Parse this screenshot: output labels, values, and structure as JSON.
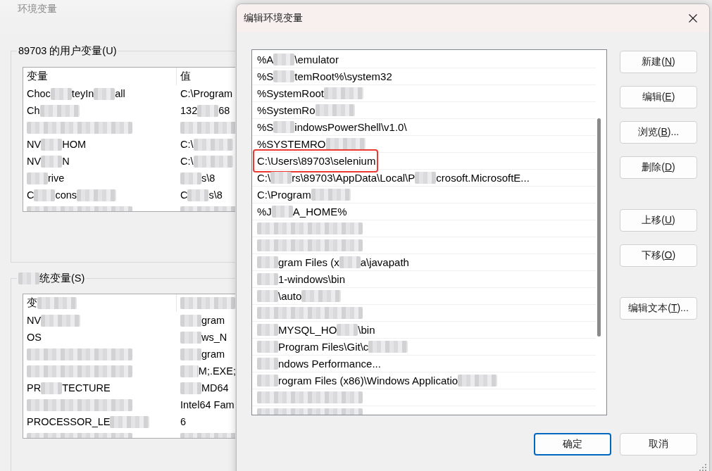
{
  "environment_window": {
    "title": "环境变量",
    "user_variables": {
      "title": [
        {
          "kind": "text",
          "text": "89703 的用户变量(U)"
        }
      ],
      "columns": [
        [
          {
            "kind": "text",
            "text": "变量"
          }
        ],
        [
          {
            "kind": "text",
            "text": "值"
          }
        ]
      ],
      "rows": [
        {
          "variable": [
            {
              "kind": "text",
              "text": "Choc"
            },
            {
              "kind": "redacted"
            },
            {
              "kind": "text",
              "text": "teyIn"
            },
            {
              "kind": "redacted"
            },
            {
              "kind": "text",
              "text": "all"
            }
          ],
          "value": [
            {
              "kind": "text",
              "text": "C:\\Program"
            }
          ]
        },
        {
          "variable": [
            {
              "kind": "text",
              "text": "Ch"
            },
            {
              "kind": "redacted"
            }
          ],
          "value": [
            {
              "kind": "text",
              "text": "132"
            },
            {
              "kind": "redacted"
            },
            {
              "kind": "text",
              "text": "68"
            }
          ]
        },
        {
          "variable": [
            {
              "kind": "redacted"
            }
          ],
          "value": [
            {
              "kind": "redacted"
            }
          ]
        },
        {
          "variable": [
            {
              "kind": "text",
              "text": "NV"
            },
            {
              "kind": "redacted"
            },
            {
              "kind": "text",
              "text": "HOM"
            }
          ],
          "value": [
            {
              "kind": "text",
              "text": "C:\\"
            },
            {
              "kind": "redacted"
            }
          ]
        },
        {
          "variable": [
            {
              "kind": "text",
              "text": "NV"
            },
            {
              "kind": "redacted"
            },
            {
              "kind": "text",
              "text": "N"
            }
          ],
          "value": [
            {
              "kind": "text",
              "text": "C:\\"
            },
            {
              "kind": "redacted"
            }
          ]
        },
        {
          "variable": [
            {
              "kind": "redacted"
            },
            {
              "kind": "text",
              "text": "rive"
            }
          ],
          "value": [
            {
              "kind": "redacted"
            },
            {
              "kind": "text",
              "text": "s\\8"
            }
          ]
        },
        {
          "variable": [
            {
              "kind": "text",
              "text": "C"
            },
            {
              "kind": "redacted"
            },
            {
              "kind": "text",
              "text": "cons"
            },
            {
              "kind": "redacted"
            }
          ],
          "value": [
            {
              "kind": "text",
              "text": "C"
            },
            {
              "kind": "redacted"
            },
            {
              "kind": "text",
              "text": "s\\8"
            }
          ]
        },
        {
          "variable": [
            {
              "kind": "redacted"
            }
          ],
          "value": [
            {
              "kind": "redacted"
            }
          ]
        }
      ]
    },
    "system_variables": {
      "title": [
        {
          "kind": "redacted"
        },
        {
          "kind": "text",
          "text": "统变量(S)"
        }
      ],
      "columns": [
        [
          {
            "kind": "text",
            "text": "变"
          },
          {
            "kind": "redacted"
          }
        ],
        [
          {
            "kind": "redacted"
          }
        ]
      ],
      "rows": [
        {
          "variable": [
            {
              "kind": "text",
              "text": "NV"
            },
            {
              "kind": "redacted"
            }
          ],
          "value": [
            {
              "kind": "redacted"
            },
            {
              "kind": "text",
              "text": "gram"
            }
          ]
        },
        {
          "variable": [
            {
              "kind": "text",
              "text": "OS"
            }
          ],
          "value": [
            {
              "kind": "redacted"
            },
            {
              "kind": "text",
              "text": "ws_N"
            }
          ]
        },
        {
          "variable": [
            {
              "kind": "redacted"
            }
          ],
          "value": [
            {
              "kind": "redacted"
            },
            {
              "kind": "text",
              "text": "gram"
            }
          ]
        },
        {
          "variable": [
            {
              "kind": "redacted"
            }
          ],
          "value": [
            {
              "kind": "redacted"
            },
            {
              "kind": "text",
              "text": "M;.EXE;"
            }
          ]
        },
        {
          "variable": [
            {
              "kind": "text",
              "text": "PR"
            },
            {
              "kind": "redacted"
            },
            {
              "kind": "text",
              "text": "TECTURE"
            }
          ],
          "value": [
            {
              "kind": "redacted"
            },
            {
              "kind": "text",
              "text": "MD64"
            }
          ]
        },
        {
          "variable": [
            {
              "kind": "redacted"
            }
          ],
          "value": [
            {
              "kind": "text",
              "text": "Intel64 Fam"
            }
          ]
        },
        {
          "variable": [
            {
              "kind": "text",
              "text": "PROCESSOR_LE"
            },
            {
              "kind": "redacted"
            }
          ],
          "value": [
            {
              "kind": "text",
              "text": "6"
            }
          ]
        },
        {
          "variable": [
            {
              "kind": "redacted"
            }
          ],
          "value": [
            {
              "kind": "redacted"
            }
          ]
        }
      ]
    }
  },
  "edit_dialog": {
    "title": "编辑环境变量",
    "paths": [
      {
        "segments": [
          {
            "kind": "text",
            "text": "%A"
          },
          {
            "kind": "redacted"
          },
          {
            "kind": "text",
            "text": "\\emulator"
          }
        ],
        "highlighted": false
      },
      {
        "segments": [
          {
            "kind": "text",
            "text": "%S"
          },
          {
            "kind": "redacted"
          },
          {
            "kind": "text",
            "text": "temRoot%\\system32"
          }
        ],
        "highlighted": false
      },
      {
        "segments": [
          {
            "kind": "text",
            "text": "%SystemRoot"
          },
          {
            "kind": "redacted"
          }
        ],
        "highlighted": false
      },
      {
        "segments": [
          {
            "kind": "text",
            "text": "%SystemRo"
          },
          {
            "kind": "redacted"
          }
        ],
        "highlighted": false
      },
      {
        "segments": [
          {
            "kind": "text",
            "text": "%S"
          },
          {
            "kind": "redacted"
          },
          {
            "kind": "text",
            "text": "indowsPowerShell\\v1.0\\"
          }
        ],
        "highlighted": false
      },
      {
        "segments": [
          {
            "kind": "text",
            "text": "%SYSTEMRO"
          },
          {
            "kind": "redacted"
          }
        ],
        "highlighted": false
      },
      {
        "segments": [
          {
            "kind": "text",
            "text": "C:\\Users\\89703\\selenium"
          }
        ],
        "highlighted": true
      },
      {
        "segments": [
          {
            "kind": "text",
            "text": "C:\\"
          },
          {
            "kind": "redacted"
          },
          {
            "kind": "text",
            "text": "rs\\89703\\AppData\\Local\\P"
          },
          {
            "kind": "redacted"
          },
          {
            "kind": "text",
            "text": "crosoft.MicrosoftE..."
          }
        ],
        "highlighted": false
      },
      {
        "segments": [
          {
            "kind": "text",
            "text": "C:\\Program"
          },
          {
            "kind": "redacted"
          }
        ],
        "highlighted": false
      },
      {
        "segments": [
          {
            "kind": "text",
            "text": "%J"
          },
          {
            "kind": "redacted"
          },
          {
            "kind": "text",
            "text": "A_HOME%"
          }
        ],
        "highlighted": false
      },
      {
        "segments": [
          {
            "kind": "redacted"
          }
        ],
        "highlighted": false
      },
      {
        "segments": [
          {
            "kind": "redacted"
          }
        ],
        "highlighted": false
      },
      {
        "segments": [
          {
            "kind": "redacted"
          },
          {
            "kind": "text",
            "text": "gram Files (x"
          },
          {
            "kind": "redacted"
          },
          {
            "kind": "text",
            "text": "a\\javapath"
          }
        ],
        "highlighted": false
      },
      {
        "segments": [
          {
            "kind": "redacted"
          },
          {
            "kind": "text",
            "text": "1-windows\\bin"
          }
        ],
        "highlighted": false
      },
      {
        "segments": [
          {
            "kind": "redacted"
          },
          {
            "kind": "text",
            "text": "\\auto"
          },
          {
            "kind": "redacted"
          }
        ],
        "highlighted": false
      },
      {
        "segments": [
          {
            "kind": "redacted"
          }
        ],
        "highlighted": false
      },
      {
        "segments": [
          {
            "kind": "redacted"
          },
          {
            "kind": "text",
            "text": "MYSQL_HO"
          },
          {
            "kind": "redacted"
          },
          {
            "kind": "text",
            "text": "\\bin"
          }
        ],
        "highlighted": false
      },
      {
        "segments": [
          {
            "kind": "redacted"
          },
          {
            "kind": "text",
            "text": "Program Files\\Git\\c"
          },
          {
            "kind": "redacted"
          }
        ],
        "highlighted": false
      },
      {
        "segments": [
          {
            "kind": "redacted"
          },
          {
            "kind": "text",
            "text": "ndows Performance..."
          }
        ],
        "highlighted": false
      },
      {
        "segments": [
          {
            "kind": "redacted"
          },
          {
            "kind": "text",
            "text": "rogram Files (x86)\\Windows Applicatio"
          },
          {
            "kind": "redacted"
          }
        ],
        "highlighted": false
      },
      {
        "segments": [
          {
            "kind": "redacted"
          }
        ],
        "highlighted": false
      },
      {
        "segments": [
          {
            "kind": "redacted"
          }
        ],
        "highlighted": false
      }
    ],
    "button_groups": [
      [
        {
          "label": "新建(",
          "mnemonic": "N",
          "suffix": ")"
        },
        {
          "label": "编辑(",
          "mnemonic": "E",
          "suffix": ")"
        },
        {
          "label": "浏览(",
          "mnemonic": "B",
          "suffix": ")..."
        },
        {
          "label": "删除(",
          "mnemonic": "D",
          "suffix": ")"
        }
      ],
      [
        {
          "label": "上移(",
          "mnemonic": "U",
          "suffix": ")"
        },
        {
          "label": "下移(",
          "mnemonic": "O",
          "suffix": ")"
        }
      ],
      [
        {
          "label": "编辑文本(",
          "mnemonic": "T",
          "suffix": ")..."
        }
      ]
    ],
    "footer_buttons": [
      {
        "label": "确定",
        "default": true
      },
      {
        "label": "取消",
        "default": false
      }
    ]
  }
}
